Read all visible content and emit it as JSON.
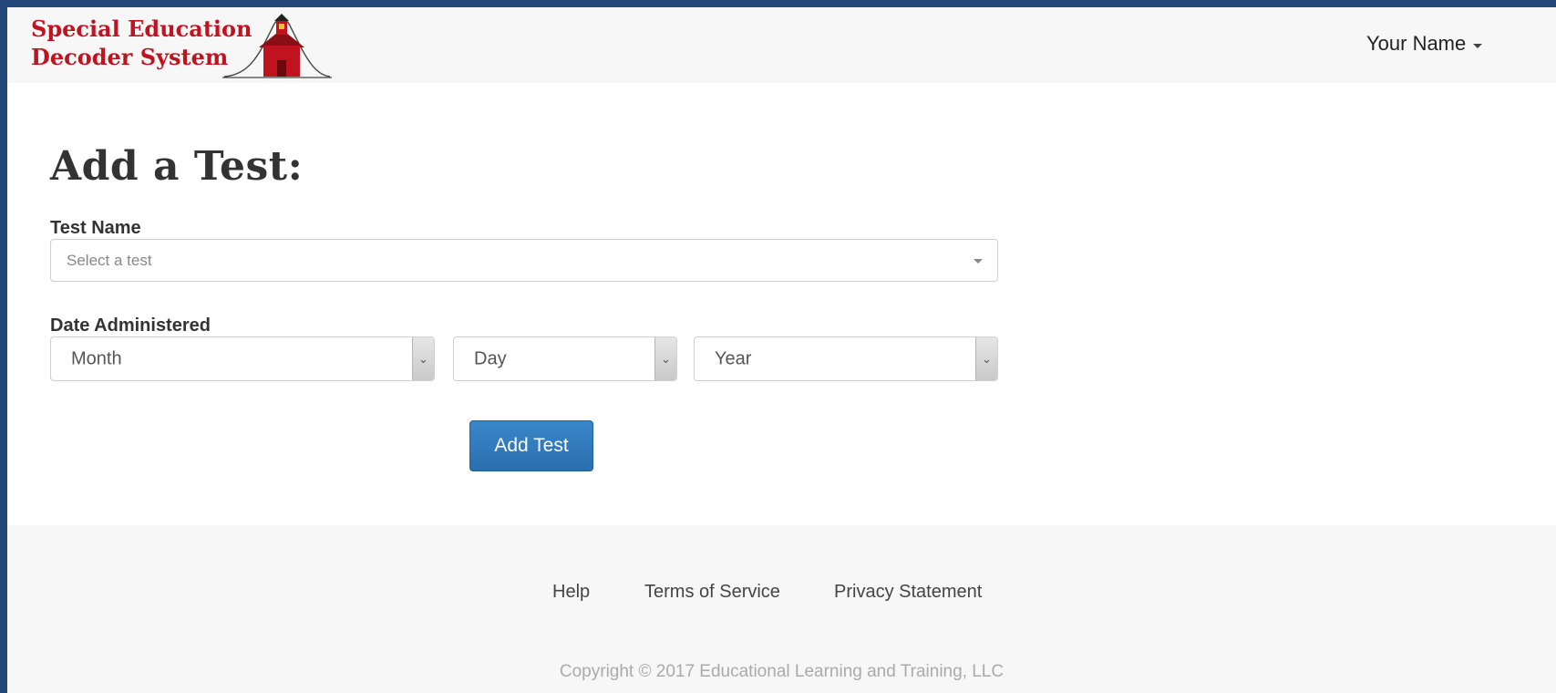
{
  "brand": {
    "line1": "Special Education",
    "line2": "Decoder System"
  },
  "user_menu": {
    "label": "Your Name"
  },
  "page": {
    "title": "Add a Test:"
  },
  "form": {
    "test_name": {
      "label": "Test Name",
      "placeholder": "Select a test"
    },
    "date_administered": {
      "label": "Date Administered",
      "month": "Month",
      "day": "Day",
      "year": "Year"
    },
    "submit_label": "Add Test"
  },
  "footer": {
    "links": [
      "Help",
      "Terms of Service",
      "Privacy Statement"
    ],
    "copyright": "Copyright © 2017 Educational Learning and Training, LLC"
  },
  "colors": {
    "brand_red": "#c1121f",
    "frame_blue": "#24487a",
    "button_blue": "#2f7ac0"
  }
}
